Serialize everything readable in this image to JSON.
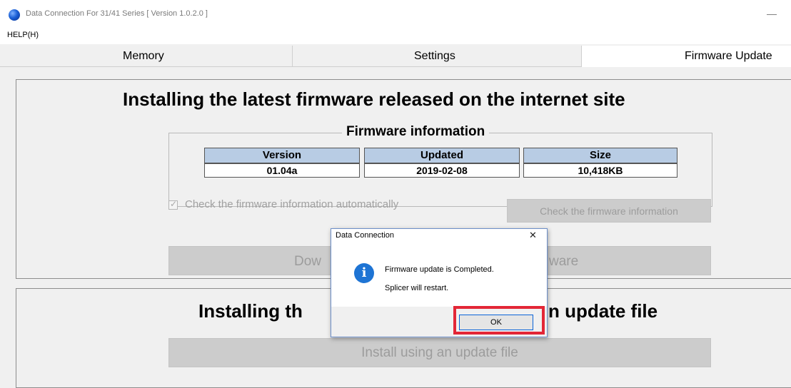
{
  "window": {
    "title": "Data Connection For 31/41 Series   [ Version 1.0.2.0 ]",
    "minimize_glyph": "—"
  },
  "menu": {
    "help": "HELP(H)"
  },
  "tabs": [
    {
      "label": "Memory"
    },
    {
      "label": "Settings"
    },
    {
      "label": "Firmware Update"
    }
  ],
  "internet_section": {
    "heading": "Installing the latest firmware released on the internet site",
    "firmware_info": {
      "legend": "Firmware information",
      "headers": [
        "Version",
        "Updated",
        "Size"
      ],
      "values": [
        "01.04a",
        "2019-02-08",
        "10,418KB"
      ]
    },
    "auto_check_label": "Check the firmware information automatically",
    "check_button": "Check the firmware information",
    "download_button_left": "Dow",
    "download_button_right": "ware"
  },
  "file_section": {
    "heading_left": "Installing th",
    "heading_right": "n update file",
    "install_button": "Install using an update file"
  },
  "dialog": {
    "title": "Data Connection",
    "close_glyph": "✕",
    "message_line1": "Firmware update is Completed.",
    "message_line2": "Splicer will restart.",
    "ok_label": "OK",
    "icon": "info-icon"
  },
  "colors": {
    "highlight": "#e32636",
    "table_header": "#b8cce4",
    "info_icon": "#1e74d4"
  }
}
